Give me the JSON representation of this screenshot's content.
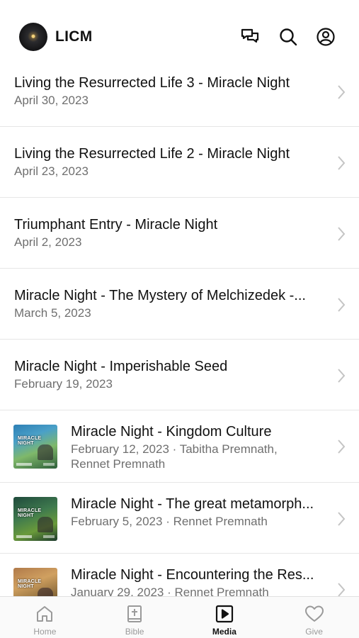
{
  "header": {
    "title": "LICM",
    "icons": [
      "chat-icon",
      "search-icon",
      "profile-icon"
    ]
  },
  "items": [
    {
      "title": "Living the Resurrected Life 3 - Miracle Night",
      "subtitle": "April 30, 2023"
    },
    {
      "title": "Living the Resurrected Life 2 - Miracle Night",
      "subtitle": "April 23, 2023"
    },
    {
      "title": "Triumphant Entry - Miracle Night",
      "subtitle": "April 2, 2023"
    },
    {
      "title": "Miracle Night - The Mystery of Melchizedek -...",
      "subtitle": "March 5, 2023"
    },
    {
      "title": "Miracle Night - Imperishable Seed",
      "subtitle": "February 19, 2023"
    },
    {
      "title": "Miracle Night - Kingdom Culture",
      "subtitle": "February 12, 2023 · Tabitha Premnath, Rennet Premnath",
      "thumb_text": "MIRACLE NIGHT"
    },
    {
      "title": "Miracle Night - The great metamorph...",
      "subtitle": "February 5, 2023 · Rennet Premnath",
      "thumb_text": "MIRACLE NIGHT"
    },
    {
      "title": "Miracle Night - Encountering the Res...",
      "subtitle": "January 29, 2023 · Rennet Premnath",
      "thumb_text": "MIRACLE NIGHT"
    }
  ],
  "tabs": [
    {
      "label": "Home",
      "icon": "home-icon",
      "active": false
    },
    {
      "label": "Bible",
      "icon": "bible-icon",
      "active": false
    },
    {
      "label": "Media",
      "icon": "media-icon",
      "active": true
    },
    {
      "label": "Give",
      "icon": "heart-icon",
      "active": false
    }
  ],
  "colors": {
    "text_primary": "#111111",
    "text_secondary": "#6f6f6f",
    "divider": "#e6e6e6",
    "tab_inactive": "#9a9a9a"
  }
}
